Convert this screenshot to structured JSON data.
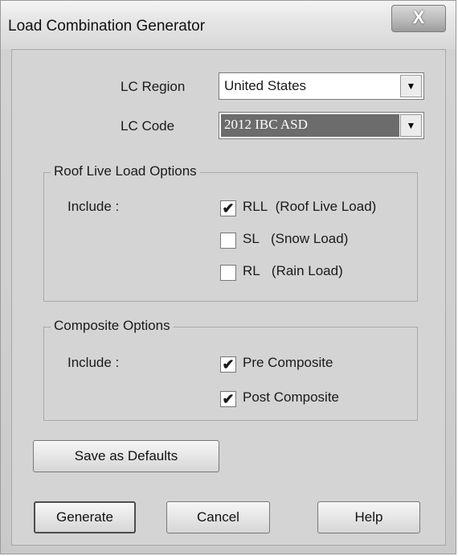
{
  "window": {
    "title": "Load Combination Generator",
    "close_glyph": "X"
  },
  "lc_region": {
    "label": "LC Region",
    "value": "United States"
  },
  "lc_code": {
    "label": "LC Code",
    "value": "2012 IBC ASD"
  },
  "roof_live_load": {
    "title": "Roof Live Load Options",
    "include_label": "Include :",
    "options": [
      {
        "code": "RLL",
        "desc": "(Roof Live Load)",
        "checked": true
      },
      {
        "code": "SL",
        "desc": "(Snow Load)",
        "checked": false
      },
      {
        "code": "RL",
        "desc": "(Rain Load)",
        "checked": false
      }
    ]
  },
  "composite": {
    "title": "Composite Options",
    "include_label": "Include :",
    "options": [
      {
        "label": "Pre Composite",
        "checked": true
      },
      {
        "label": "Post Composite",
        "checked": true
      }
    ]
  },
  "buttons": {
    "save_defaults": "Save as Defaults",
    "generate": "Generate",
    "cancel": "Cancel",
    "help": "Help"
  },
  "check_glyph": "✔",
  "arrow_glyph": "▼"
}
